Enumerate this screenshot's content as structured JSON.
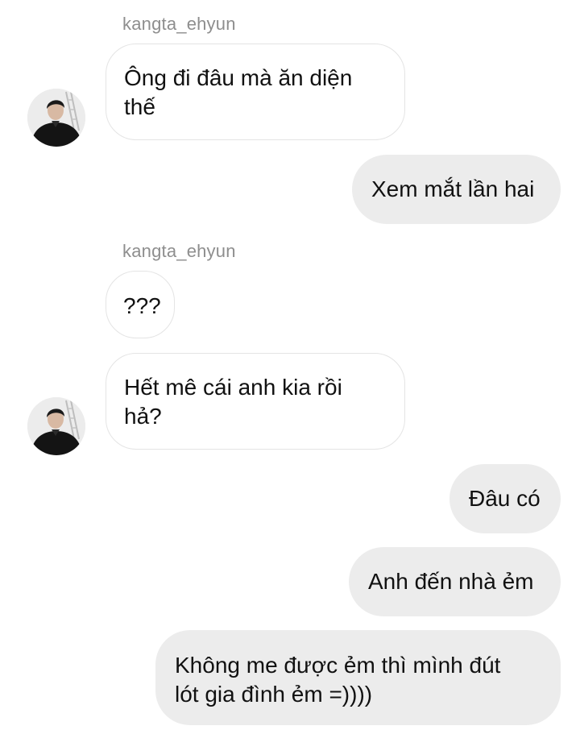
{
  "thread": {
    "messages": [
      {
        "id": "m1",
        "direction": "incoming",
        "sender": "kangta_ehyun",
        "text": "Ông đi đâu mà ăn diện thế",
        "lines": [
          "Ông đi đâu mà ăn diện",
          "thế"
        ]
      },
      {
        "id": "m2",
        "direction": "outgoing",
        "text": "Xem mắt lần hai"
      },
      {
        "id": "m3",
        "direction": "incoming",
        "sender": "kangta_ehyun",
        "text": "???"
      },
      {
        "id": "m4",
        "direction": "incoming",
        "text": "Hết mê cái anh kia rồi hả?",
        "lines": [
          "Hết mê cái anh kia rồi",
          "hả?"
        ]
      },
      {
        "id": "m5",
        "direction": "outgoing",
        "text": "Đâu có"
      },
      {
        "id": "m6",
        "direction": "outgoing",
        "text": "Anh đến nhà ẻm"
      },
      {
        "id": "m7",
        "direction": "outgoing",
        "text": "Không me được ẻm thì mình đút lót gia đình ẻm =))))",
        "lines": [
          "Không me được ẻm thì mình đút",
          "lót gia đình ẻm =))))"
        ]
      }
    ]
  },
  "avatar": {
    "icon": "profile-photo-icon"
  },
  "colors": {
    "incoming_bubble_bg": "#ffffff",
    "incoming_bubble_border": "#e4e4e4",
    "outgoing_bubble_bg": "#ececec",
    "sender_name": "#8e8e8e",
    "text": "#111111"
  }
}
